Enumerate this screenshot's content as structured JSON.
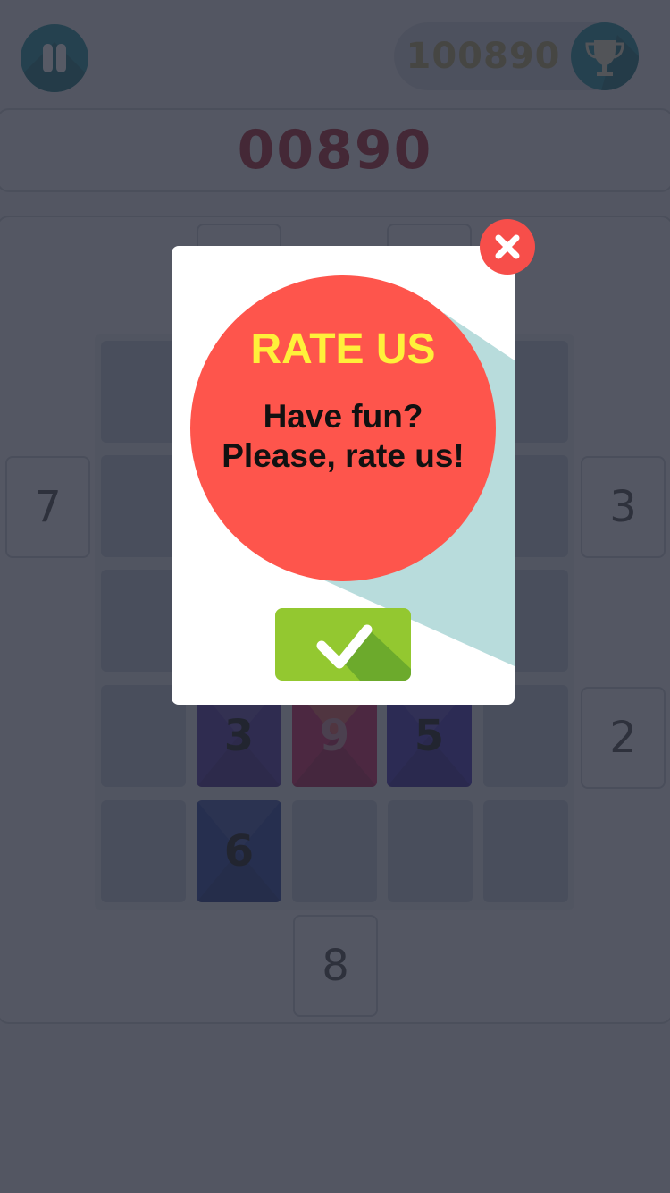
{
  "hud": {
    "best_score": "100890",
    "current_score": "00890"
  },
  "side_tiles": {
    "left": "7",
    "right_top": "3",
    "right_bottom": "2",
    "bottom": "8"
  },
  "board_tiles": [
    {
      "value": "3",
      "color": "#4b2fa0"
    },
    {
      "value": "9",
      "color": "#cc1f5c"
    },
    {
      "value": "5",
      "color": "#3e2ab2"
    },
    {
      "value": "6",
      "color": "#233c9a"
    }
  ],
  "dialog": {
    "title": "RATE US",
    "line1": "Have fun?",
    "line2": "Please, rate us!"
  },
  "icons": {
    "pause": "pause-icon",
    "trophy": "trophy-icon",
    "close": "close-icon",
    "check": "checkmark-icon"
  },
  "colors": {
    "teal": "#1e8e99",
    "red": "#fe554c",
    "yellow": "#fff03a",
    "green": "#93c830"
  }
}
